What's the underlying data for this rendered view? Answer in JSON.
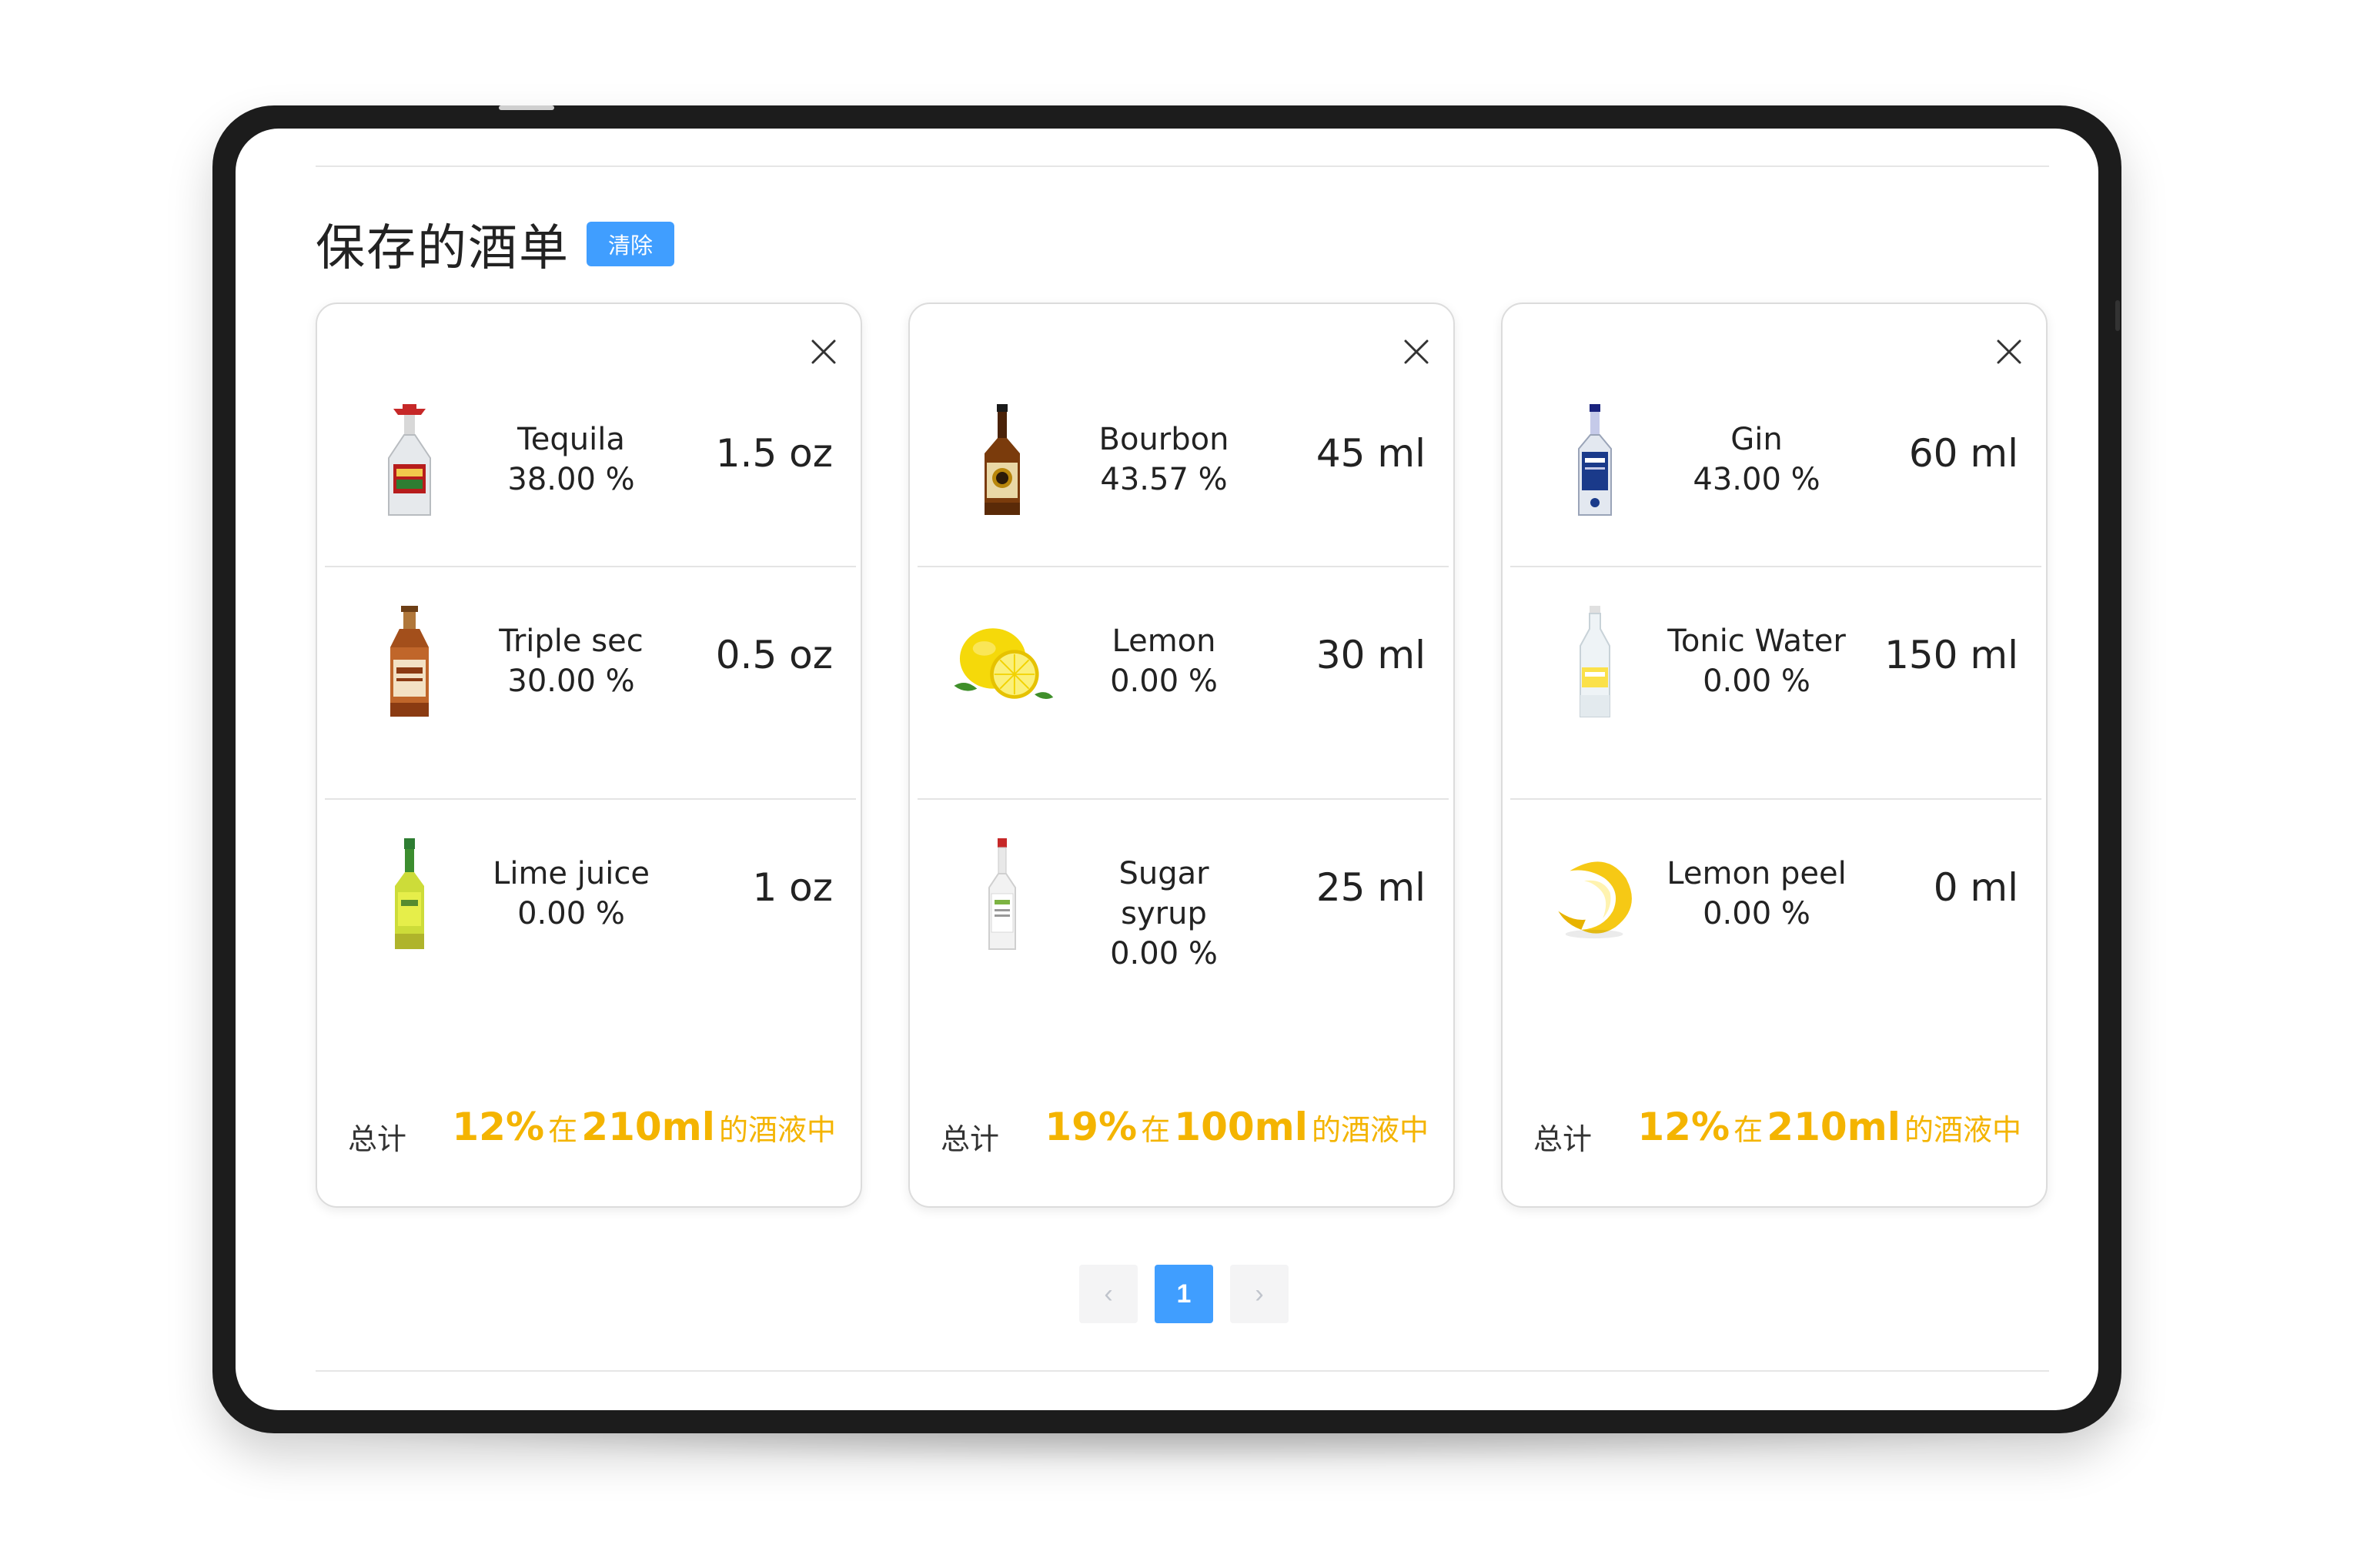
{
  "header": {
    "title": "保存的酒单",
    "clear_label": "清除"
  },
  "cards": [
    {
      "ingredients": [
        {
          "name": "Tequila",
          "abv": "38.00 %",
          "amount": "1.5 oz",
          "icon": "tequila-bottle-icon"
        },
        {
          "name": "Triple sec",
          "abv": "30.00 %",
          "amount": "0.5 oz",
          "icon": "triple-sec-bottle-icon"
        },
        {
          "name": "Lime juice",
          "abv": "0.00 %",
          "amount": "1 oz",
          "icon": "lime-juice-bottle-icon"
        }
      ],
      "total": {
        "label": "总计",
        "percent": "12%",
        "in": "在",
        "volume": "210ml",
        "suffix": "的酒液中"
      }
    },
    {
      "ingredients": [
        {
          "name": "Bourbon",
          "abv": "43.57 %",
          "amount": "45 ml",
          "icon": "bourbon-bottle-icon"
        },
        {
          "name": "Lemon",
          "abv": "0.00 %",
          "amount": "30 ml",
          "icon": "lemon-icon"
        },
        {
          "name": "Sugar syrup",
          "abv": "0.00 %",
          "amount": "25 ml",
          "icon": "syrup-bottle-icon"
        }
      ],
      "total": {
        "label": "总计",
        "percent": "19%",
        "in": "在",
        "volume": "100ml",
        "suffix": "的酒液中"
      }
    },
    {
      "ingredients": [
        {
          "name": "Gin",
          "abv": "43.00 %",
          "amount": "60 ml",
          "icon": "gin-bottle-icon"
        },
        {
          "name": "Tonic Water",
          "abv": "0.00 %",
          "amount": "150 ml",
          "icon": "tonic-water-bottle-icon"
        },
        {
          "name": "Lemon peel",
          "abv": "0.00 %",
          "amount": "0 ml",
          "icon": "lemon-peel-icon"
        }
      ],
      "total": {
        "label": "总计",
        "percent": "12%",
        "in": "在",
        "volume": "210ml",
        "suffix": "的酒液中"
      }
    }
  ],
  "pagination": {
    "prev": "‹",
    "current": "1",
    "next": "›"
  },
  "colors": {
    "accent": "#409eff",
    "total_highlight": "#f4b400",
    "text": "#222222",
    "divider": "#e4e4e4"
  }
}
